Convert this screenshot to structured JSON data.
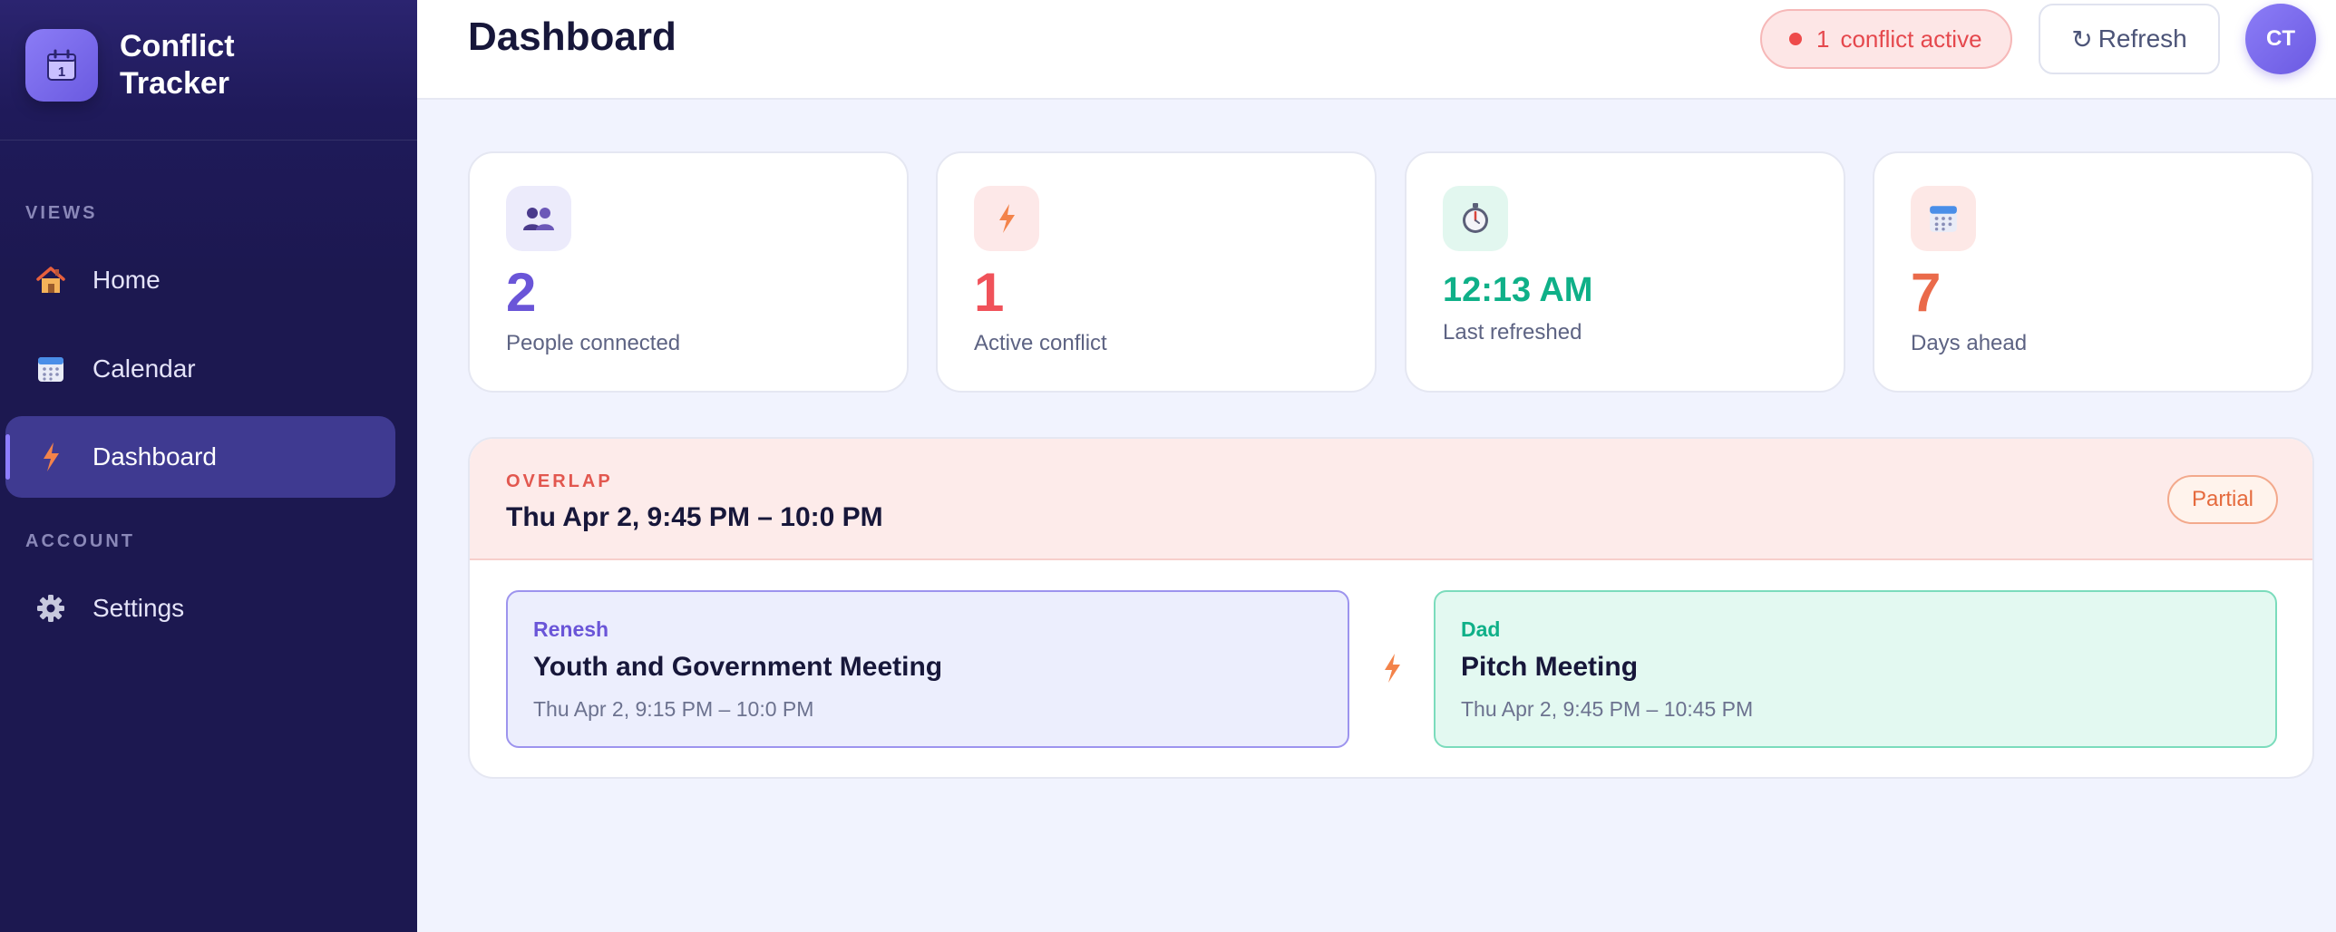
{
  "app": {
    "name": "Conflict Tracker",
    "logo_glyph": "1"
  },
  "sidebar": {
    "sections": [
      {
        "label": "VIEWS"
      },
      {
        "label": "ACCOUNT"
      }
    ],
    "items": [
      {
        "label": "Home",
        "icon": "house-icon",
        "active": false
      },
      {
        "label": "Calendar",
        "icon": "calendar-icon",
        "active": false
      },
      {
        "label": "Dashboard",
        "icon": "lightning-icon",
        "active": true
      },
      {
        "label": "Settings",
        "icon": "gear-icon",
        "active": false
      }
    ]
  },
  "header": {
    "title": "Dashboard",
    "conflict_count": "1",
    "conflict_text": "conflict active",
    "refresh_icon": "↻",
    "refresh_label": "Refresh",
    "avatar_initials": "CT"
  },
  "stats": [
    {
      "value": "2",
      "label": "People connected",
      "icon": "people-icon",
      "color": "#6a55d8"
    },
    {
      "value": "1",
      "label": "Active conflict",
      "icon": "lightning-icon",
      "color": "#f0525a"
    },
    {
      "value": "12:13 AM",
      "label": "Last refreshed",
      "icon": "stopwatch-icon",
      "color": "#0fb088"
    },
    {
      "value": "7",
      "label": "Days ahead",
      "icon": "calendar-icon",
      "color": "#ea6a4a"
    }
  ],
  "conflict": {
    "label": "OVERLAP",
    "time": "Thu Apr 2, 9:45 PM – 10:0 PM",
    "badge": "Partial",
    "events": [
      {
        "person": "Renesh",
        "title": "Youth and Government Meeting",
        "time": "Thu Apr 2, 9:15 PM – 10:0 PM",
        "color": "#6a55d8"
      },
      {
        "person": "Dad",
        "title": "Pitch Meeting",
        "time": "Thu Apr 2, 9:45 PM – 10:45 PM",
        "color": "#0fb088"
      }
    ]
  },
  "colors": {
    "sidebar_bg": "#1c1850",
    "accent": "#6a5ae0",
    "danger": "#e5484d",
    "page_bg": "#f1f3fe"
  }
}
